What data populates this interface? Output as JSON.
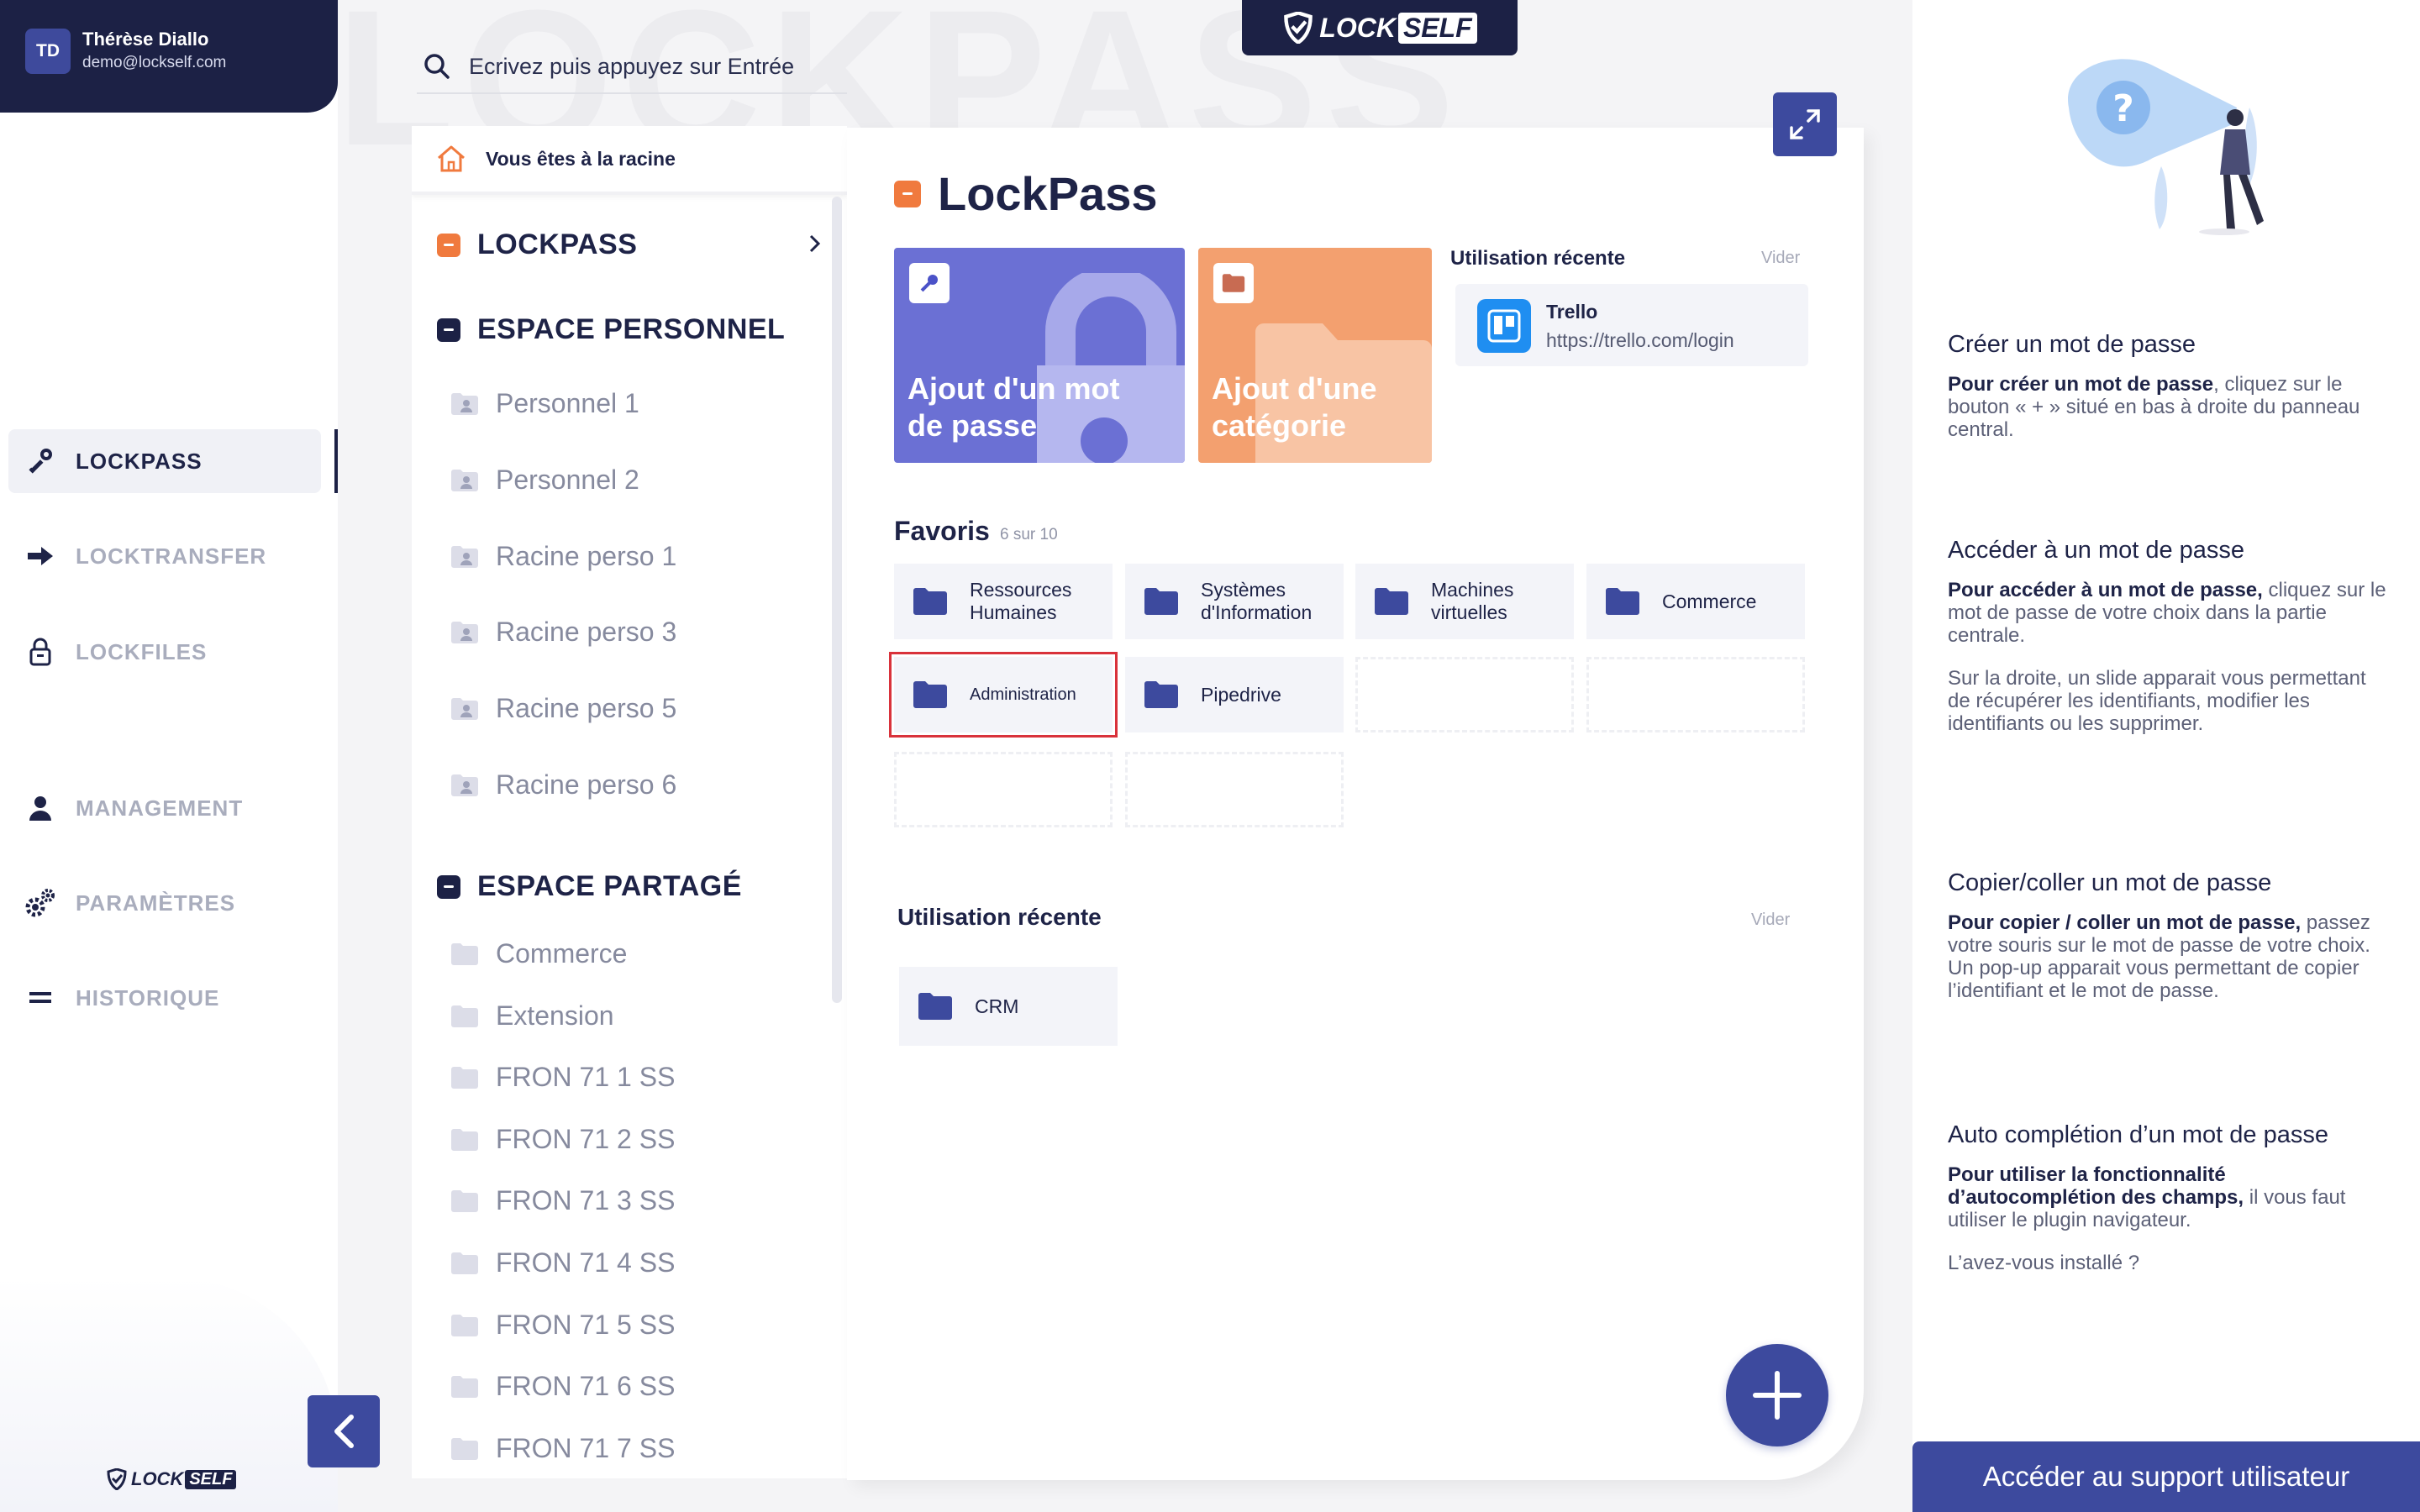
{
  "user": {
    "initials": "TD",
    "name": "Thérèse Diallo",
    "email": "demo@lockself.com"
  },
  "brand": {
    "logo_lock": "LOCK",
    "logo_self": "SELF",
    "watermark": "LOCKPASS"
  },
  "colors": {
    "navy": "#1c2145",
    "accent": "#3d4a9e",
    "orange": "#f07a3e",
    "purple_card": "#6b70d4",
    "orange_card": "#f3a06f"
  },
  "nav": {
    "items": [
      {
        "label": "LOCKPASS",
        "icon": "key-icon",
        "active": true
      },
      {
        "label": "LOCKTRANSFER",
        "icon": "arrow-right-icon",
        "active": false
      },
      {
        "label": "LOCKFILES",
        "icon": "lock-file-icon",
        "active": false
      },
      {
        "label": "MANAGEMENT",
        "icon": "user-icon",
        "active": false
      },
      {
        "label": "PARAMÈTRES",
        "icon": "gears-icon",
        "active": false
      },
      {
        "label": "HISTORIQUE",
        "icon": "history-icon",
        "active": false
      }
    ]
  },
  "search": {
    "placeholder": "Ecrivez puis appuyez sur Entrée"
  },
  "tree": {
    "root_label": "Vous êtes à la racine",
    "lockpass": "LOCKPASS",
    "personal": {
      "title": "ESPACE PERSONNEL",
      "items": [
        "Personnel 1",
        "Personnel 2",
        "Racine perso 1",
        "Racine perso 3",
        "Racine perso 5",
        "Racine perso 6"
      ]
    },
    "shared": {
      "title": "ESPACE PARTAGÉ",
      "items": [
        "Commerce",
        "Extension",
        "FRON 71 1 SS",
        "FRON 71 2 SS",
        "FRON 71 3 SS",
        "FRON 71 4 SS",
        "FRON 71 5 SS",
        "FRON 71 6 SS",
        "FRON 71 7 SS"
      ]
    }
  },
  "main": {
    "title": "LockPass",
    "card_add_password": "Ajout d'un mot de passe",
    "card_add_category": "Ajout d'une catégorie",
    "recent_top": {
      "title": "Utilisation récente",
      "clear": "Vider",
      "item_name": "Trello",
      "item_url": "https://trello.com/login"
    },
    "favorites": {
      "title": "Favoris",
      "count": "6 sur 10",
      "items": [
        "Ressources Humaines",
        "Systèmes d'Information",
        "Machines virtuelles",
        "Commerce",
        "Administration",
        "Pipedrive"
      ]
    },
    "recent": {
      "title": "Utilisation récente",
      "clear": "Vider",
      "items": [
        "CRM"
      ]
    }
  },
  "help": {
    "sections": [
      {
        "title": "Créer un mot de passe",
        "bold": "Pour créer un mot de passe",
        "text": ", cliquez sur le bouton « + » situé en bas à droite du panneau central."
      },
      {
        "title": "Accéder à un mot de passe",
        "bold": "Pour accéder à un mot de passe,",
        "text": " cliquez sur le mot de passe de votre choix dans la partie centrale.",
        "extra": "Sur la droite, un slide apparait vous permettant de récupérer les identifiants, modifier les identifiants ou les supprimer."
      },
      {
        "title": "Copier/coller un mot de passe",
        "bold": "Pour copier / coller un mot de passe,",
        "text": " passez votre souris sur le mot de passe de votre choix. Un pop-up apparait vous permettant de copier l’identifiant et le mot de passe."
      },
      {
        "title": "Auto complétion d’un mot de passe",
        "bold": "Pour utiliser la fonctionnalité d’autocomplétion des champs,",
        "text": " il vous faut utiliser le plugin navigateur.",
        "extra": "L’avez-vous installé ?"
      }
    ],
    "support_button": "Accéder au support utilisateur"
  }
}
